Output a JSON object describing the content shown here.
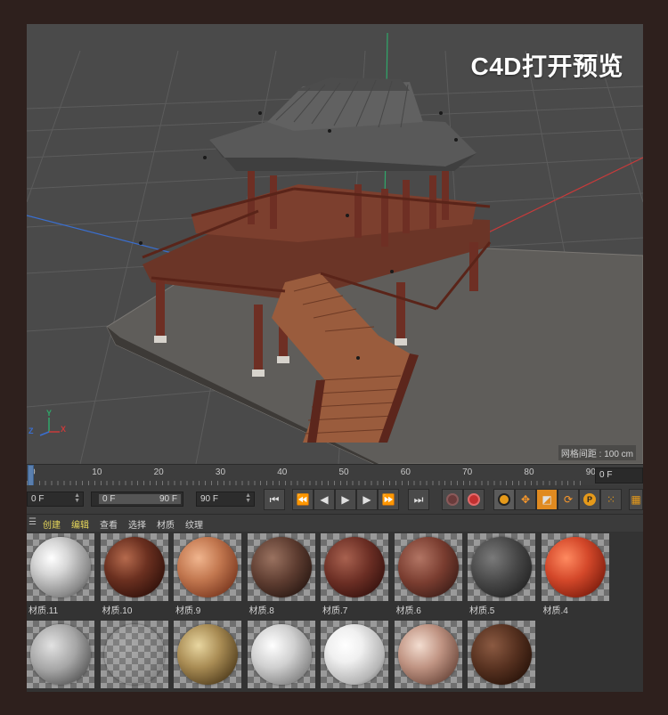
{
  "overlay_title": "C4D打开预览",
  "viewport": {
    "title": "",
    "grid_spacing": "网格间距 : 100 cm",
    "axes": {
      "y": "Y",
      "z": "Z",
      "x": "X"
    }
  },
  "timeline": {
    "ticks": [
      "0",
      "10",
      "20",
      "30",
      "40",
      "50",
      "60",
      "70",
      "80",
      "90"
    ],
    "current_frame": "0 F"
  },
  "transport": {
    "start_frame": "0 F",
    "range_start": "0 F",
    "range_end": "90 F",
    "end_frame": "90 F",
    "buttons": [
      "go-start",
      "prev-key",
      "prev-frame",
      "play",
      "next-frame",
      "next-key",
      "go-end",
      "record-off",
      "record-auto",
      "key-selection",
      "move",
      "scale",
      "rotate",
      "param",
      "grid"
    ]
  },
  "material_menu": {
    "items": [
      "创建",
      "编辑",
      "查看",
      "选择",
      "材质",
      "纹理"
    ],
    "highlighted": [
      "创建",
      "编辑"
    ]
  },
  "materials": [
    {
      "label": "材质.11",
      "ball": "radial-gradient(circle at 35% 35%, #ffffff 0%, #d6d6d6 30%, #8a8a8a 70%, #2b2b2b 100%)"
    },
    {
      "label": "材质.10",
      "ball": "radial-gradient(circle at 35% 35%, #b56a4d 0%, #6b3020 40%, #3a160e 75%, #150604 100%)"
    },
    {
      "label": "材质.9",
      "ball": "radial-gradient(circle at 35% 35%, #f0b58e 0%, #c2774f 40%, #864227 75%, #3d1a0c 100%)"
    },
    {
      "label": "材质.8",
      "ball": "radial-gradient(circle at 35% 35%, #9a7260 0%, #5d3c30 45%, #2d1b15 80%, #120a07 100%)"
    },
    {
      "label": "材质.7",
      "ball": "radial-gradient(circle at 35% 35%, #a8614f 0%, #6b2e24 45%, #3a1410 80%, #170705 100%)"
    },
    {
      "label": "材质.6",
      "ball": "radial-gradient(circle at 35% 35%, #b27564 0%, #7a3d30 45%, #43201a 80%, #1a0a07 100%)"
    },
    {
      "label": "材质.5",
      "ball": "radial-gradient(circle at 35% 35%, #7a7a7a 0%, #474747 45%, #262626 80%, #0e0e0e 100%)"
    },
    {
      "label": "材质.4",
      "ball": "radial-gradient(circle at 35% 35%, #ff8a60 0%, #d4482a 40%, #8c2412 75%, #3a0a04 100%)"
    },
    {
      "label": "",
      "ball": "radial-gradient(circle at 35% 35%, #e2e2e2 0%, #a5a5a5 45%, #5c5c5c 80%, #2a2a2a 100%)"
    },
    {
      "label": "",
      "ball": "radial-gradient(circle at 35% 35%, rgba(255,255,255,0.15) 0%, rgba(160,160,160,0.1) 60%, rgba(40,40,40,0.35) 100%)"
    },
    {
      "label": "",
      "ball": "radial-gradient(circle at 35% 35%, #e8d6a0 0%, #a98c54 40%, #5f4a26 75%, #241a0b 100%)"
    },
    {
      "label": "",
      "ball": "radial-gradient(circle at 35% 35%, #ffffff 0%, #d0d0d0 40%, #8d8d8d 75%, #3c3c3c 100%)"
    },
    {
      "label": "",
      "ball": "radial-gradient(circle at 35% 35%, #ffffff 0%, #f0f0f0 30%, #b5b5b5 70%, #4a4a4a 100%)"
    },
    {
      "label": "",
      "ball": "radial-gradient(circle at 35% 35%, #f3ddd0 0%, #c09483 40%, #7a5548 75%, #2e1d17 100%)"
    },
    {
      "label": "",
      "ball": "radial-gradient(circle at 35% 35%, #8b5a42 0%, #55301f 45%, #2b150b 80%, #0f0603 100%)"
    }
  ]
}
